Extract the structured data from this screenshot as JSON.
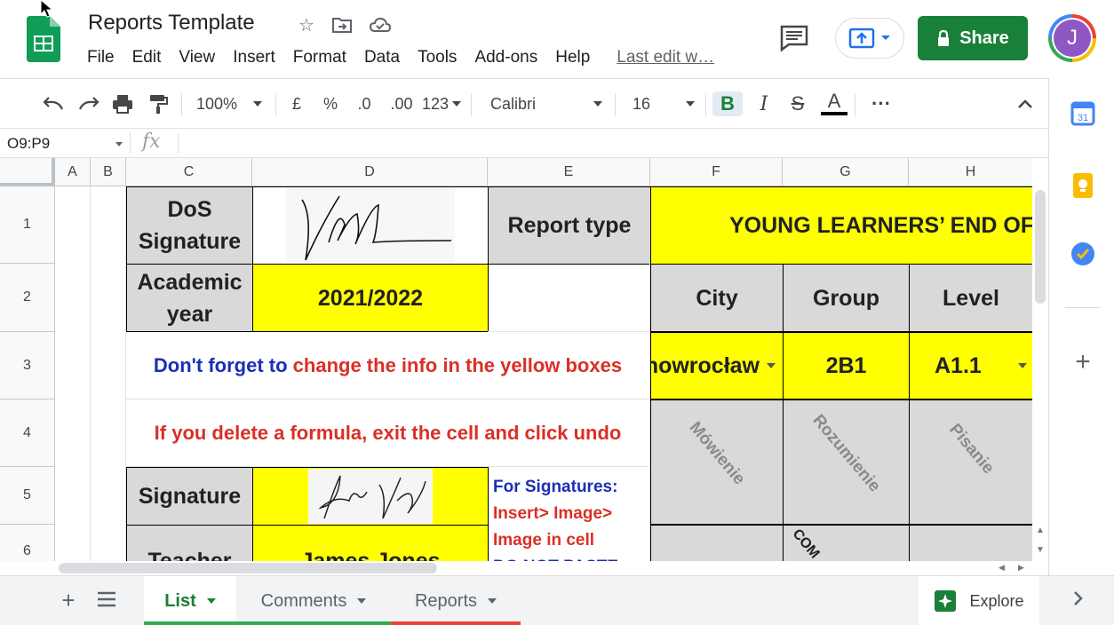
{
  "header": {
    "doc_title": "Reports Template",
    "menu": [
      "File",
      "Edit",
      "View",
      "Insert",
      "Format",
      "Data",
      "Tools",
      "Add-ons",
      "Help"
    ],
    "last_edit": "Last edit w…",
    "share_label": "Share",
    "avatar_initial": "J"
  },
  "toolbar": {
    "zoom": "100%",
    "currency": "£",
    "percent": "%",
    "dec_decrease": ".0",
    "dec_increase": ".00",
    "more_formats": "123",
    "font": "Calibri",
    "font_size": "16",
    "bold": "B",
    "italic": "I",
    "strike": "S",
    "text_color": "A",
    "more": "···"
  },
  "formula_bar": {
    "name_box": "O9:P9",
    "fx": "fx",
    "content": ""
  },
  "grid": {
    "columns": [
      "A",
      "B",
      "C",
      "D",
      "E",
      "F",
      "G",
      "H"
    ],
    "rows": [
      "1",
      "2",
      "3",
      "4",
      "5",
      "6"
    ],
    "cells": {
      "c1": "DoS Signature",
      "e1": "Report type",
      "f1": "YOUNG LEARNERS’ END OF",
      "c2": "Academic year",
      "d2": "2021/2022",
      "f2": "City",
      "g2": "Group",
      "h2": "Level",
      "note3_blue": "Don't forget to ",
      "note3_red": "change the info in the yellow boxes",
      "f3": "nowrocław",
      "g3": "2B1",
      "h3": "A1.1",
      "note4": "If you delete a formula, exit the cell and click undo",
      "f4": "Mówienie",
      "g4": "Rozumienie",
      "h4": "Pisanie",
      "c5": "Signature",
      "e5_1": "For Signatures:",
      "e5_2": "Insert> Image>",
      "e5_3": "Image in cell",
      "e5_4": "DO NOT PASTE",
      "c6": "Teacher",
      "d6": "James Jones",
      "g6": "COM"
    }
  },
  "tabs": [
    "List",
    "Comments",
    "Reports"
  ],
  "explore_label": "Explore",
  "colors": {
    "yellow": "#ffff00",
    "gray": "#d9d9d9",
    "green": "#188038",
    "note_blue": "#1a2fb4",
    "note_red": "#d93025"
  }
}
